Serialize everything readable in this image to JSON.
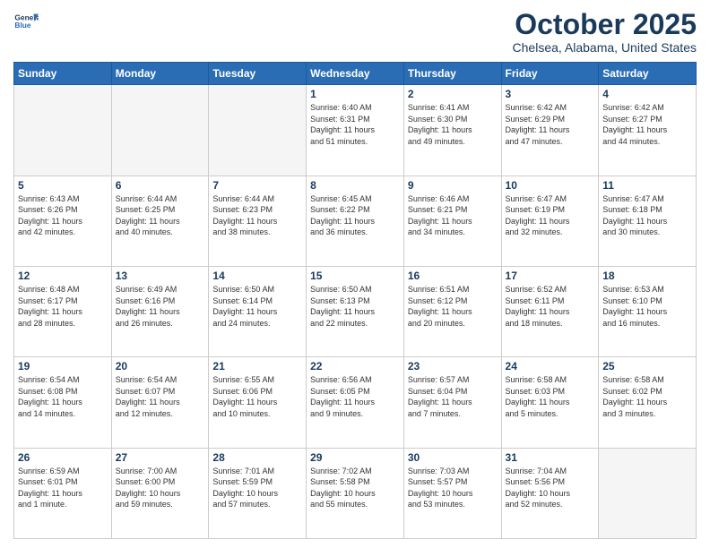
{
  "header": {
    "logo_general": "General",
    "logo_blue": "Blue",
    "month_title": "October 2025",
    "location": "Chelsea, Alabama, United States"
  },
  "days_of_week": [
    "Sunday",
    "Monday",
    "Tuesday",
    "Wednesday",
    "Thursday",
    "Friday",
    "Saturday"
  ],
  "weeks": [
    [
      {
        "day": "",
        "info": ""
      },
      {
        "day": "",
        "info": ""
      },
      {
        "day": "",
        "info": ""
      },
      {
        "day": "1",
        "info": "Sunrise: 6:40 AM\nSunset: 6:31 PM\nDaylight: 11 hours\nand 51 minutes."
      },
      {
        "day": "2",
        "info": "Sunrise: 6:41 AM\nSunset: 6:30 PM\nDaylight: 11 hours\nand 49 minutes."
      },
      {
        "day": "3",
        "info": "Sunrise: 6:42 AM\nSunset: 6:29 PM\nDaylight: 11 hours\nand 47 minutes."
      },
      {
        "day": "4",
        "info": "Sunrise: 6:42 AM\nSunset: 6:27 PM\nDaylight: 11 hours\nand 44 minutes."
      }
    ],
    [
      {
        "day": "5",
        "info": "Sunrise: 6:43 AM\nSunset: 6:26 PM\nDaylight: 11 hours\nand 42 minutes."
      },
      {
        "day": "6",
        "info": "Sunrise: 6:44 AM\nSunset: 6:25 PM\nDaylight: 11 hours\nand 40 minutes."
      },
      {
        "day": "7",
        "info": "Sunrise: 6:44 AM\nSunset: 6:23 PM\nDaylight: 11 hours\nand 38 minutes."
      },
      {
        "day": "8",
        "info": "Sunrise: 6:45 AM\nSunset: 6:22 PM\nDaylight: 11 hours\nand 36 minutes."
      },
      {
        "day": "9",
        "info": "Sunrise: 6:46 AM\nSunset: 6:21 PM\nDaylight: 11 hours\nand 34 minutes."
      },
      {
        "day": "10",
        "info": "Sunrise: 6:47 AM\nSunset: 6:19 PM\nDaylight: 11 hours\nand 32 minutes."
      },
      {
        "day": "11",
        "info": "Sunrise: 6:47 AM\nSunset: 6:18 PM\nDaylight: 11 hours\nand 30 minutes."
      }
    ],
    [
      {
        "day": "12",
        "info": "Sunrise: 6:48 AM\nSunset: 6:17 PM\nDaylight: 11 hours\nand 28 minutes."
      },
      {
        "day": "13",
        "info": "Sunrise: 6:49 AM\nSunset: 6:16 PM\nDaylight: 11 hours\nand 26 minutes."
      },
      {
        "day": "14",
        "info": "Sunrise: 6:50 AM\nSunset: 6:14 PM\nDaylight: 11 hours\nand 24 minutes."
      },
      {
        "day": "15",
        "info": "Sunrise: 6:50 AM\nSunset: 6:13 PM\nDaylight: 11 hours\nand 22 minutes."
      },
      {
        "day": "16",
        "info": "Sunrise: 6:51 AM\nSunset: 6:12 PM\nDaylight: 11 hours\nand 20 minutes."
      },
      {
        "day": "17",
        "info": "Sunrise: 6:52 AM\nSunset: 6:11 PM\nDaylight: 11 hours\nand 18 minutes."
      },
      {
        "day": "18",
        "info": "Sunrise: 6:53 AM\nSunset: 6:10 PM\nDaylight: 11 hours\nand 16 minutes."
      }
    ],
    [
      {
        "day": "19",
        "info": "Sunrise: 6:54 AM\nSunset: 6:08 PM\nDaylight: 11 hours\nand 14 minutes."
      },
      {
        "day": "20",
        "info": "Sunrise: 6:54 AM\nSunset: 6:07 PM\nDaylight: 11 hours\nand 12 minutes."
      },
      {
        "day": "21",
        "info": "Sunrise: 6:55 AM\nSunset: 6:06 PM\nDaylight: 11 hours\nand 10 minutes."
      },
      {
        "day": "22",
        "info": "Sunrise: 6:56 AM\nSunset: 6:05 PM\nDaylight: 11 hours\nand 9 minutes."
      },
      {
        "day": "23",
        "info": "Sunrise: 6:57 AM\nSunset: 6:04 PM\nDaylight: 11 hours\nand 7 minutes."
      },
      {
        "day": "24",
        "info": "Sunrise: 6:58 AM\nSunset: 6:03 PM\nDaylight: 11 hours\nand 5 minutes."
      },
      {
        "day": "25",
        "info": "Sunrise: 6:58 AM\nSunset: 6:02 PM\nDaylight: 11 hours\nand 3 minutes."
      }
    ],
    [
      {
        "day": "26",
        "info": "Sunrise: 6:59 AM\nSunset: 6:01 PM\nDaylight: 11 hours\nand 1 minute."
      },
      {
        "day": "27",
        "info": "Sunrise: 7:00 AM\nSunset: 6:00 PM\nDaylight: 10 hours\nand 59 minutes."
      },
      {
        "day": "28",
        "info": "Sunrise: 7:01 AM\nSunset: 5:59 PM\nDaylight: 10 hours\nand 57 minutes."
      },
      {
        "day": "29",
        "info": "Sunrise: 7:02 AM\nSunset: 5:58 PM\nDaylight: 10 hours\nand 55 minutes."
      },
      {
        "day": "30",
        "info": "Sunrise: 7:03 AM\nSunset: 5:57 PM\nDaylight: 10 hours\nand 53 minutes."
      },
      {
        "day": "31",
        "info": "Sunrise: 7:04 AM\nSunset: 5:56 PM\nDaylight: 10 hours\nand 52 minutes."
      },
      {
        "day": "",
        "info": ""
      }
    ]
  ]
}
